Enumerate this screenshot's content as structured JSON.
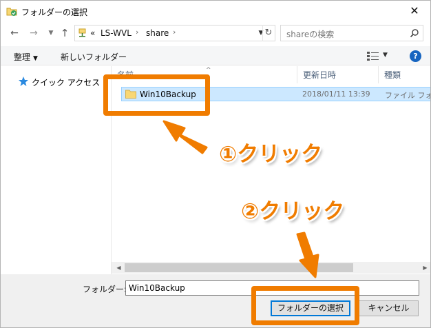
{
  "window": {
    "title": "フォルダーの選択",
    "close_label": "✕"
  },
  "navigation": {
    "back_icon": "arrow-left-icon",
    "forward_icon": "arrow-right-icon",
    "recent_icon": "chevron-down-icon",
    "up_icon": "arrow-up-icon",
    "address_prefix": "«",
    "breadcrumbs": [
      "LS-WVL",
      "share"
    ],
    "separator": "›",
    "search_placeholder": "shareの検索"
  },
  "toolbar": {
    "organize_label": "整理",
    "new_folder_label": "新しいフォルダー",
    "help_label": "?"
  },
  "nav_pane": {
    "quick_access_label": "クイック アクセス"
  },
  "file_list": {
    "columns": [
      "名前",
      "更新日時",
      "種類"
    ],
    "rows": [
      {
        "name": "Win10Backup",
        "date": "2018/01/11 13:39",
        "type": "ファイル フォルダー"
      }
    ]
  },
  "footer": {
    "folder_label": "フォルダー:",
    "folder_value": "Win10Backup",
    "select_button_label": "フォルダーの選択",
    "cancel_button_label": "キャンセル"
  },
  "annotations": {
    "step1_label": "①クリック",
    "step2_label": "②クリック",
    "accent_color": "#f07c00"
  }
}
